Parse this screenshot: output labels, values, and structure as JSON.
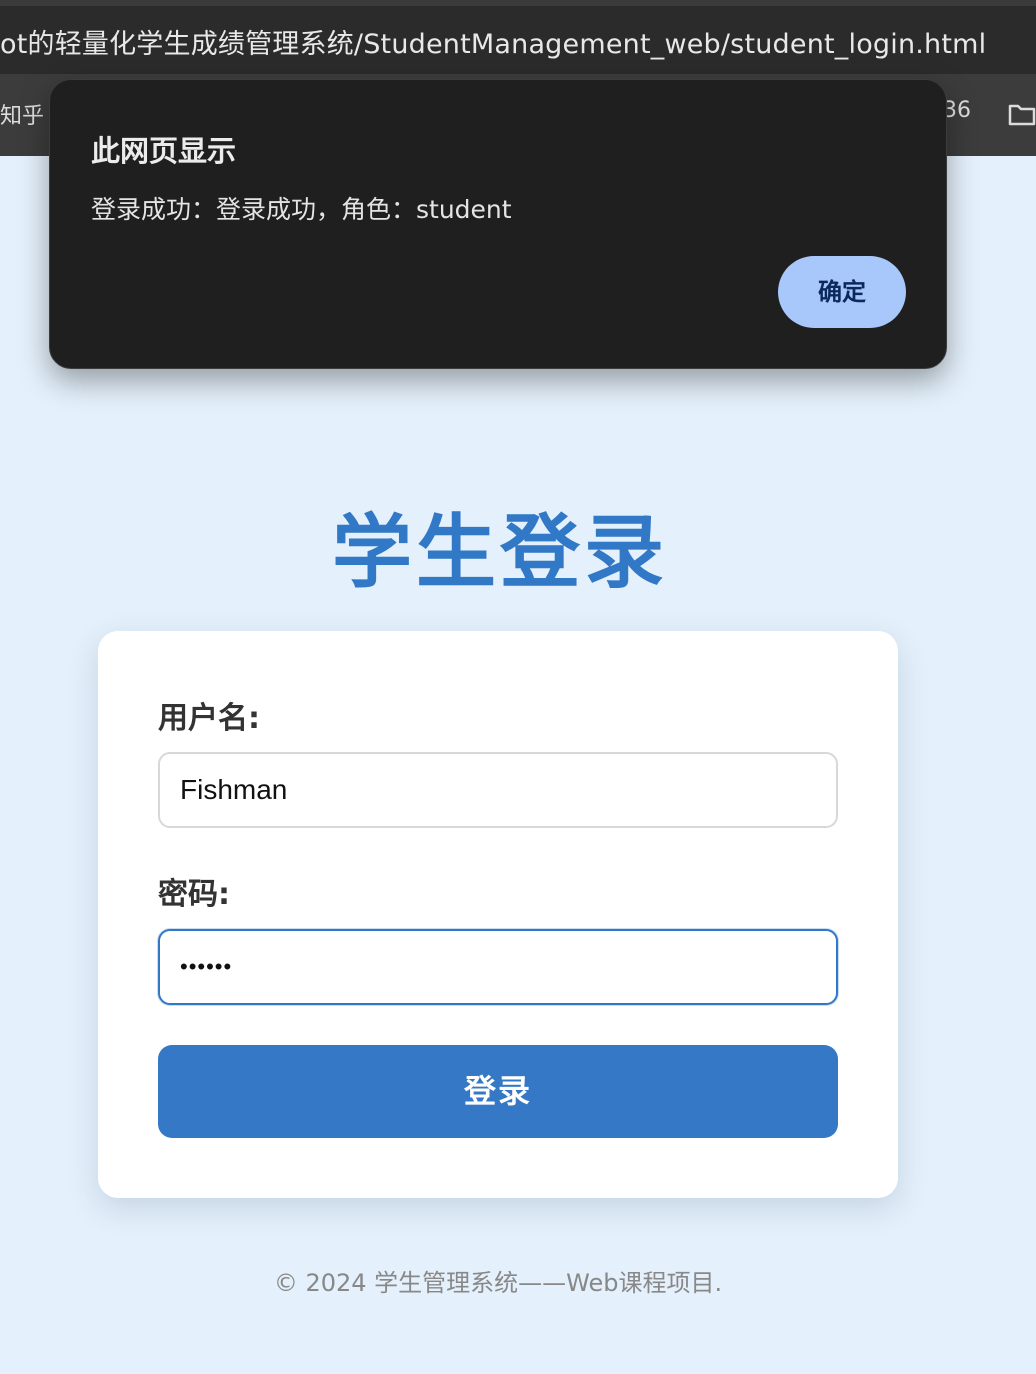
{
  "browser": {
    "address": "ot的轻量化学生成绩管理系统/StudentManagement_web/student_login.html",
    "bookmark_left": "知乎",
    "bookmark_right_partial": "36",
    "folder_icon": "folder-icon"
  },
  "page": {
    "title": "学生登录",
    "username_label": "用户名:",
    "username_value": "Fishman",
    "password_label": "密码:",
    "password_masked": "••••••",
    "login_button": "登录",
    "footer": "© 2024 学生管理系统——Web课程项目."
  },
  "dialog": {
    "title": "此网页显示",
    "message": "登录成功：登录成功，角色：student",
    "ok_button": "确定"
  },
  "colors": {
    "page_background": "#e4f0fb",
    "accent": "#3578c6",
    "dialog_background": "#1f1f1f",
    "dialog_button": "#a8c7fa"
  }
}
